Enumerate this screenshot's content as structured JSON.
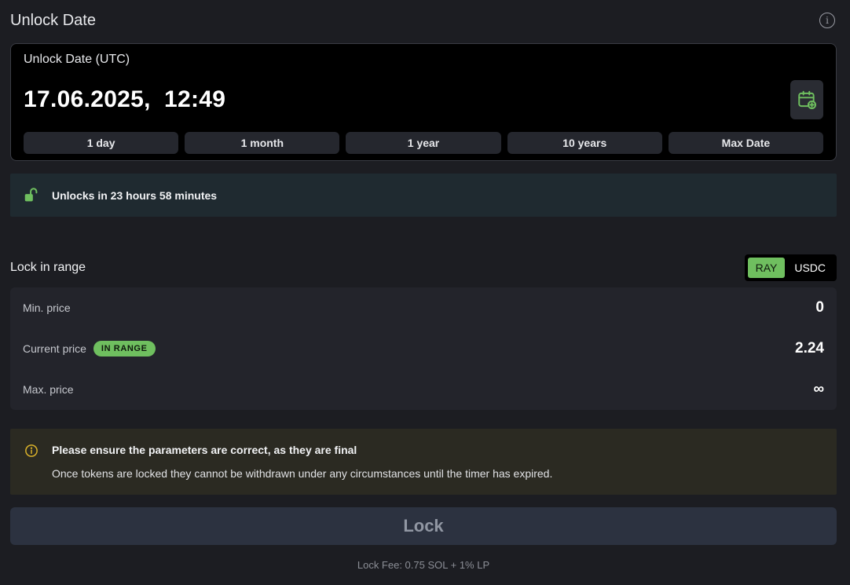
{
  "header": {
    "title": "Unlock Date"
  },
  "date_card": {
    "label": "Unlock Date (UTC)",
    "value": "17.06.2025,  12:49",
    "presets": [
      "1 day",
      "1 month",
      "1 year",
      "10 years",
      "Max Date"
    ]
  },
  "unlock_banner": {
    "text": "Unlocks in 23 hours 58 minutes"
  },
  "range": {
    "title": "Lock in range",
    "toggle": [
      {
        "label": "RAY",
        "active": true
      },
      {
        "label": "USDC",
        "active": false
      }
    ],
    "rows": {
      "min_label": "Min. price",
      "min_value": "0",
      "current_label": "Current price",
      "current_badge": "IN RANGE",
      "current_value": "2.24",
      "max_label": "Max. price",
      "max_value": "∞"
    }
  },
  "warning": {
    "title": "Please ensure the parameters are correct, as they are final",
    "text": "Once tokens are locked they cannot be withdrawn under any circumstances until the timer has expired."
  },
  "action": {
    "lock_label": "Lock"
  },
  "fee": {
    "text": "Lock Fee: 0.75 SOL + 1% LP"
  },
  "colors": {
    "accent_green": "#6fbf5f",
    "background": "#1c1d22",
    "banner_bg": "#1f2a30",
    "warning_bg": "#2b2a22",
    "warning_icon": "#d9b12a"
  },
  "icons": {
    "info": "info-icon",
    "calendar": "calendar-plus-icon",
    "unlock": "unlock-icon",
    "warning": "warning-icon"
  }
}
